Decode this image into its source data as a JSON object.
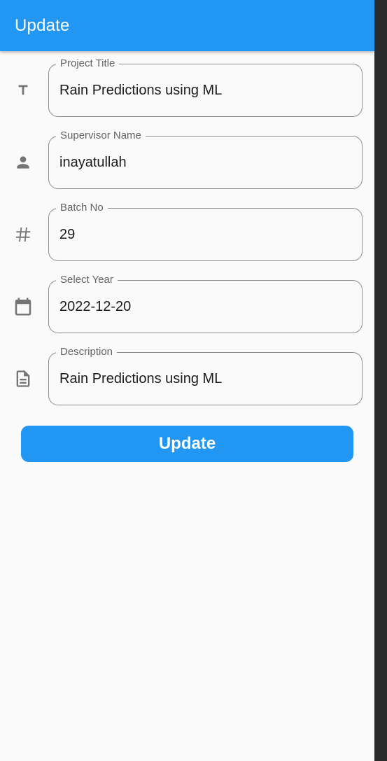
{
  "appbar": {
    "title": "Update",
    "color": "#2196f3"
  },
  "fields": [
    {
      "label": "Project Title",
      "value": "Rain Predictions using ML",
      "icon": "text-title-icon"
    },
    {
      "label": "Supervisor Name",
      "value": "inayatullah",
      "icon": "person-icon"
    },
    {
      "label": "Batch No",
      "value": "29",
      "icon": "hash-icon"
    },
    {
      "label": "Select Year",
      "value": "2022-12-20",
      "icon": "calendar-icon"
    },
    {
      "label": "Description",
      "value": "Rain Predictions using ML",
      "icon": "document-icon"
    }
  ],
  "update_button": {
    "label": "Update"
  }
}
